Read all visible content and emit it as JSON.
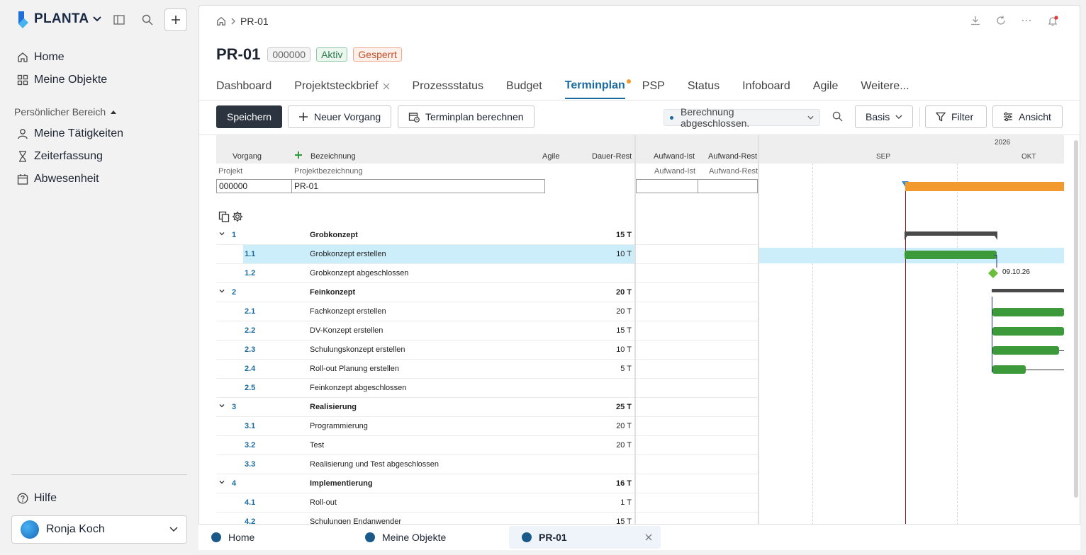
{
  "sidebar": {
    "brand": "PLANTA",
    "nav": [
      {
        "label": "Home",
        "icon": "home-icon"
      },
      {
        "label": "Meine Objekte",
        "icon": "grid-icon"
      }
    ],
    "section_title": "Persönlicher Bereich",
    "section_items": [
      {
        "label": "Meine Tätigkeiten",
        "icon": "person-icon"
      },
      {
        "label": "Zeiterfassung",
        "icon": "hourglass-icon"
      },
      {
        "label": "Abwesenheit",
        "icon": "calendar-icon"
      }
    ],
    "help": "Hilfe",
    "user": "Ronja Koch"
  },
  "breadcrumb": {
    "current": "PR-01"
  },
  "header": {
    "title": "PR-01",
    "badges": [
      {
        "text": "000000",
        "color": "#666666",
        "bg": "#f4f4f4"
      },
      {
        "text": "Aktiv",
        "color": "#2e7d4f",
        "bg": "#eaf6ee"
      },
      {
        "text": "Gesperrt",
        "color": "#c0502a",
        "bg": "#fdf0ea"
      }
    ]
  },
  "tabs": [
    "Dashboard",
    "Projektsteckbrief",
    "Prozessstatus",
    "Budget",
    "Terminplan",
    "PSP",
    "Status",
    "Infoboard",
    "Agile",
    "Weitere..."
  ],
  "active_tab": "Terminplan",
  "toolbar": {
    "save": "Speichern",
    "new_task": "Neuer Vorgang",
    "calculate": "Terminplan berechnen",
    "status": "Berechnung abgeschlossen.",
    "basis": "Basis",
    "filter": "Filter",
    "view": "Ansicht"
  },
  "grid": {
    "headers": {
      "vorgang": "Vorgang",
      "bezeichnung": "Bezeichnung",
      "agile": "Agile",
      "dauer_rest": "Dauer-Rest",
      "aufwand_ist": "Aufwand-Ist",
      "aufwand_rest": "Aufwand-Rest"
    },
    "subheaders": {
      "projekt": "Projekt",
      "projektbezeichnung": "Projektbezeichnung",
      "aufwand_ist": "Aufwand-Ist",
      "aufwand_rest": "Aufwand-Rest"
    },
    "project_id": "000000",
    "project_name": "PR-01",
    "rows": [
      {
        "num": "1",
        "name": "Grobkonzept",
        "dur": "15 T",
        "group": true
      },
      {
        "num": "1.1",
        "name": "Grobkonzept erstellen",
        "dur": "10 T",
        "selected": true
      },
      {
        "num": "1.2",
        "name": "Grobkonzept abgeschlossen",
        "dur": ""
      },
      {
        "num": "2",
        "name": "Feinkonzept",
        "dur": "20 T",
        "group": true
      },
      {
        "num": "2.1",
        "name": "Fachkonzept erstellen",
        "dur": "20 T"
      },
      {
        "num": "2.2",
        "name": "DV-Konzept erstellen",
        "dur": "15 T"
      },
      {
        "num": "2.3",
        "name": "Schulungskonzept erstellen",
        "dur": "10 T"
      },
      {
        "num": "2.4",
        "name": "Roll-out Planung erstellen",
        "dur": "5 T"
      },
      {
        "num": "2.5",
        "name": "Feinkonzept abgeschlossen",
        "dur": ""
      },
      {
        "num": "3",
        "name": "Realisierung",
        "dur": "25 T",
        "group": true
      },
      {
        "num": "3.1",
        "name": "Programmierung",
        "dur": "20 T"
      },
      {
        "num": "3.2",
        "name": "Test",
        "dur": "20 T"
      },
      {
        "num": "3.3",
        "name": "Realisierung und Test abgeschlossen",
        "dur": ""
      },
      {
        "num": "4",
        "name": "Implementierung",
        "dur": "16 T",
        "group": true
      },
      {
        "num": "4.1",
        "name": "Roll-out",
        "dur": "1 T"
      },
      {
        "num": "4.2",
        "name": "Schulungen Endanwender",
        "dur": "15 T"
      }
    ]
  },
  "gantt": {
    "year": "2026",
    "months": [
      "SEP",
      "OKT"
    ],
    "milestone_label": "09.10.26",
    "colors": {
      "project_bar": "#f29a2e",
      "task_bar": "#3d9a3b",
      "today_line": "#8b1a1a",
      "milestone": "#6bbf3a"
    }
  },
  "bottom_tabs": [
    {
      "label": "Home"
    },
    {
      "label": "Meine Objekte"
    },
    {
      "label": "PR-01",
      "active": true
    }
  ]
}
